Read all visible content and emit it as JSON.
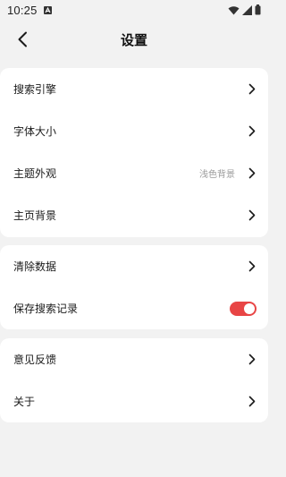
{
  "status_bar": {
    "time": "10:25"
  },
  "header": {
    "title": "设置"
  },
  "groups": [
    {
      "items": [
        {
          "label": "搜索引擎"
        },
        {
          "label": "字体大小"
        },
        {
          "label": "主题外观",
          "value": "浅色背景"
        },
        {
          "label": "主页背景"
        }
      ]
    },
    {
      "items": [
        {
          "label": "清除数据"
        },
        {
          "label": "保存搜索记录",
          "toggle": true
        }
      ]
    },
    {
      "items": [
        {
          "label": "意见反馈"
        },
        {
          "label": "关于"
        }
      ]
    }
  ],
  "colors": {
    "accent": "#e84545",
    "background": "#f2f2f2",
    "card": "#ffffff"
  },
  "icons": {
    "back": "arrow-left-icon",
    "chevron": "chevron-right-icon"
  }
}
